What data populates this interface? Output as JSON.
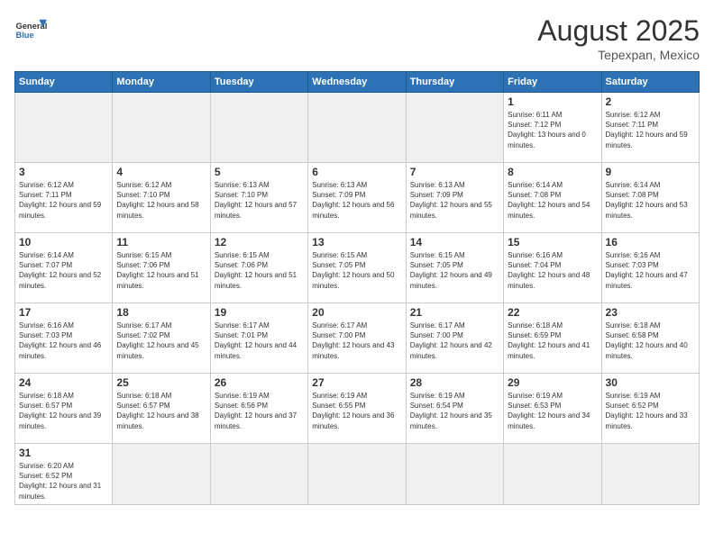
{
  "header": {
    "logo_general": "General",
    "logo_blue": "Blue",
    "month_title": "August 2025",
    "location": "Tepexpan, Mexico"
  },
  "days_of_week": [
    "Sunday",
    "Monday",
    "Tuesday",
    "Wednesday",
    "Thursday",
    "Friday",
    "Saturday"
  ],
  "weeks": [
    [
      {
        "day": "",
        "empty": true
      },
      {
        "day": "",
        "empty": true
      },
      {
        "day": "",
        "empty": true
      },
      {
        "day": "",
        "empty": true
      },
      {
        "day": "",
        "empty": true
      },
      {
        "day": "1",
        "sunrise": "6:11 AM",
        "sunset": "7:12 PM",
        "daylight": "13 hours and 0 minutes."
      },
      {
        "day": "2",
        "sunrise": "6:12 AM",
        "sunset": "7:11 PM",
        "daylight": "12 hours and 59 minutes."
      }
    ],
    [
      {
        "day": "3",
        "sunrise": "6:12 AM",
        "sunset": "7:11 PM",
        "daylight": "12 hours and 59 minutes."
      },
      {
        "day": "4",
        "sunrise": "6:12 AM",
        "sunset": "7:10 PM",
        "daylight": "12 hours and 58 minutes."
      },
      {
        "day": "5",
        "sunrise": "6:13 AM",
        "sunset": "7:10 PM",
        "daylight": "12 hours and 57 minutes."
      },
      {
        "day": "6",
        "sunrise": "6:13 AM",
        "sunset": "7:09 PM",
        "daylight": "12 hours and 56 minutes."
      },
      {
        "day": "7",
        "sunrise": "6:13 AM",
        "sunset": "7:09 PM",
        "daylight": "12 hours and 55 minutes."
      },
      {
        "day": "8",
        "sunrise": "6:14 AM",
        "sunset": "7:08 PM",
        "daylight": "12 hours and 54 minutes."
      },
      {
        "day": "9",
        "sunrise": "6:14 AM",
        "sunset": "7:08 PM",
        "daylight": "12 hours and 53 minutes."
      }
    ],
    [
      {
        "day": "10",
        "sunrise": "6:14 AM",
        "sunset": "7:07 PM",
        "daylight": "12 hours and 52 minutes."
      },
      {
        "day": "11",
        "sunrise": "6:15 AM",
        "sunset": "7:06 PM",
        "daylight": "12 hours and 51 minutes."
      },
      {
        "day": "12",
        "sunrise": "6:15 AM",
        "sunset": "7:06 PM",
        "daylight": "12 hours and 51 minutes."
      },
      {
        "day": "13",
        "sunrise": "6:15 AM",
        "sunset": "7:05 PM",
        "daylight": "12 hours and 50 minutes."
      },
      {
        "day": "14",
        "sunrise": "6:15 AM",
        "sunset": "7:05 PM",
        "daylight": "12 hours and 49 minutes."
      },
      {
        "day": "15",
        "sunrise": "6:16 AM",
        "sunset": "7:04 PM",
        "daylight": "12 hours and 48 minutes."
      },
      {
        "day": "16",
        "sunrise": "6:16 AM",
        "sunset": "7:03 PM",
        "daylight": "12 hours and 47 minutes."
      }
    ],
    [
      {
        "day": "17",
        "sunrise": "6:16 AM",
        "sunset": "7:03 PM",
        "daylight": "12 hours and 46 minutes."
      },
      {
        "day": "18",
        "sunrise": "6:17 AM",
        "sunset": "7:02 PM",
        "daylight": "12 hours and 45 minutes."
      },
      {
        "day": "19",
        "sunrise": "6:17 AM",
        "sunset": "7:01 PM",
        "daylight": "12 hours and 44 minutes."
      },
      {
        "day": "20",
        "sunrise": "6:17 AM",
        "sunset": "7:00 PM",
        "daylight": "12 hours and 43 minutes."
      },
      {
        "day": "21",
        "sunrise": "6:17 AM",
        "sunset": "7:00 PM",
        "daylight": "12 hours and 42 minutes."
      },
      {
        "day": "22",
        "sunrise": "6:18 AM",
        "sunset": "6:59 PM",
        "daylight": "12 hours and 41 minutes."
      },
      {
        "day": "23",
        "sunrise": "6:18 AM",
        "sunset": "6:58 PM",
        "daylight": "12 hours and 40 minutes."
      }
    ],
    [
      {
        "day": "24",
        "sunrise": "6:18 AM",
        "sunset": "6:57 PM",
        "daylight": "12 hours and 39 minutes."
      },
      {
        "day": "25",
        "sunrise": "6:18 AM",
        "sunset": "6:57 PM",
        "daylight": "12 hours and 38 minutes."
      },
      {
        "day": "26",
        "sunrise": "6:19 AM",
        "sunset": "6:56 PM",
        "daylight": "12 hours and 37 minutes."
      },
      {
        "day": "27",
        "sunrise": "6:19 AM",
        "sunset": "6:55 PM",
        "daylight": "12 hours and 36 minutes."
      },
      {
        "day": "28",
        "sunrise": "6:19 AM",
        "sunset": "6:54 PM",
        "daylight": "12 hours and 35 minutes."
      },
      {
        "day": "29",
        "sunrise": "6:19 AM",
        "sunset": "6:53 PM",
        "daylight": "12 hours and 34 minutes."
      },
      {
        "day": "30",
        "sunrise": "6:19 AM",
        "sunset": "6:52 PM",
        "daylight": "12 hours and 33 minutes."
      }
    ],
    [
      {
        "day": "31",
        "sunrise": "6:20 AM",
        "sunset": "6:52 PM",
        "daylight": "12 hours and 31 minutes."
      },
      {
        "day": "",
        "empty": true
      },
      {
        "day": "",
        "empty": true
      },
      {
        "day": "",
        "empty": true
      },
      {
        "day": "",
        "empty": true
      },
      {
        "day": "",
        "empty": true
      },
      {
        "day": "",
        "empty": true
      }
    ]
  ]
}
